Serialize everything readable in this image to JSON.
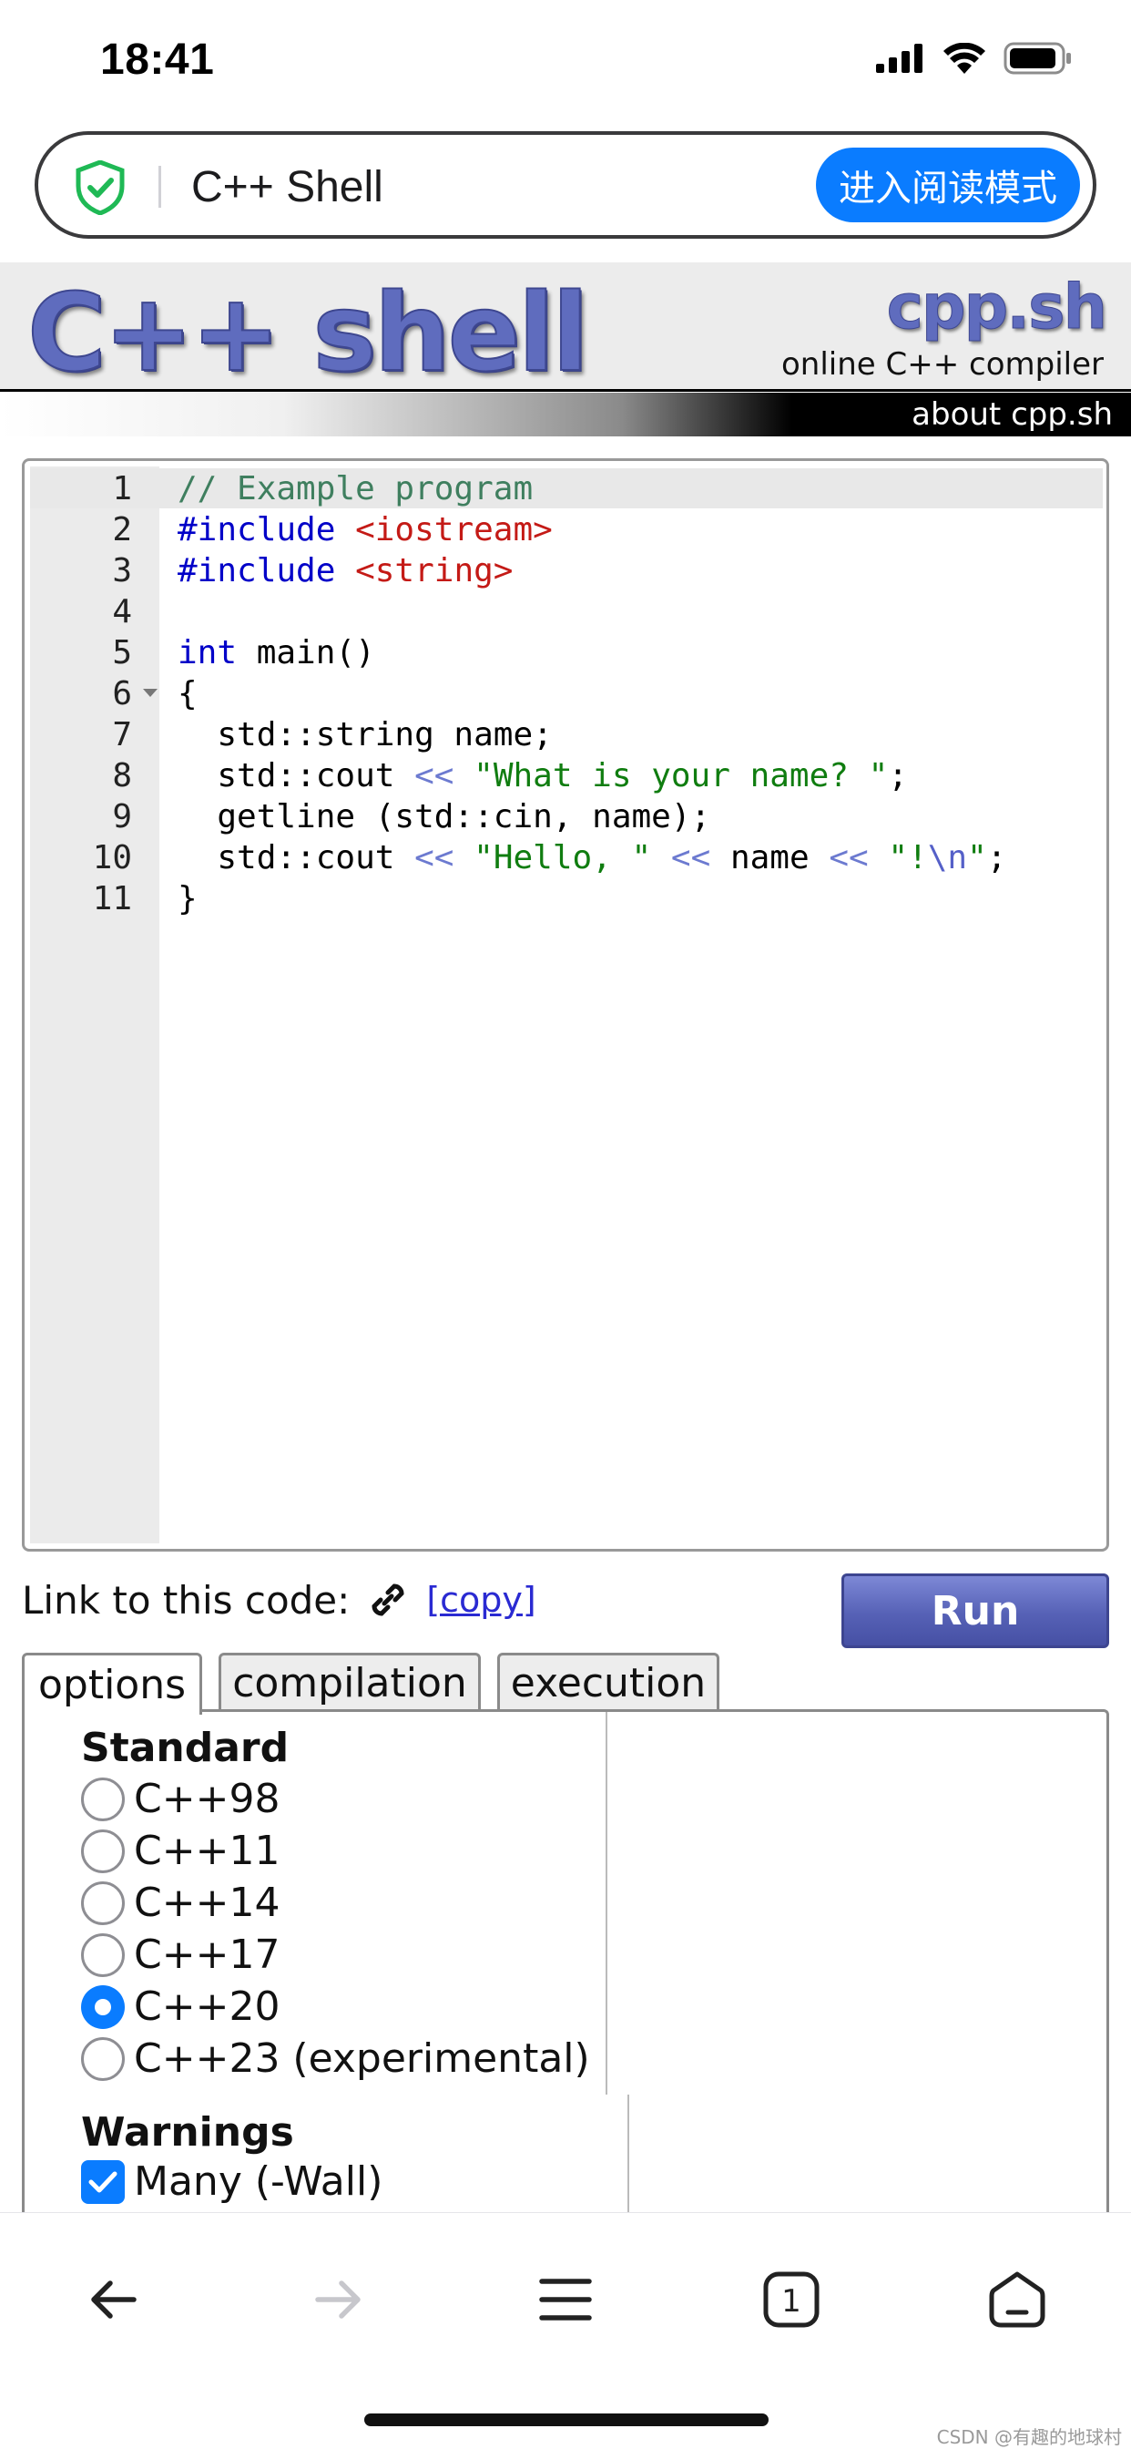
{
  "status": {
    "time": "18:41"
  },
  "browser": {
    "tab_title": "C++ Shell",
    "reader_mode_label": "进入阅读模式"
  },
  "header": {
    "logo": "C++ shell",
    "site_name": "cpp.sh",
    "tagline": "online C++ compiler",
    "about_link": "about cpp.sh"
  },
  "editor": {
    "lines": [
      {
        "n": "1",
        "segs": [
          [
            "com",
            "// Example program"
          ]
        ]
      },
      {
        "n": "2",
        "segs": [
          [
            "pre",
            "#include "
          ],
          [
            "inc",
            "<iostream>"
          ]
        ]
      },
      {
        "n": "3",
        "segs": [
          [
            "pre",
            "#include "
          ],
          [
            "inc",
            "<string>"
          ]
        ]
      },
      {
        "n": "4",
        "segs": []
      },
      {
        "n": "5",
        "segs": [
          [
            "kw",
            "int"
          ],
          [
            "txt",
            " main()"
          ]
        ]
      },
      {
        "n": "6",
        "segs": [
          [
            "txt",
            "{"
          ]
        ],
        "fold": true
      },
      {
        "n": "7",
        "segs": [
          [
            "txt",
            "  std::string name;"
          ]
        ]
      },
      {
        "n": "8",
        "segs": [
          [
            "txt",
            "  std::cout "
          ],
          [
            "op",
            "<<"
          ],
          [
            "txt",
            " "
          ],
          [
            "str",
            "\"What is your name? \""
          ],
          [
            "txt",
            ";"
          ]
        ]
      },
      {
        "n": "9",
        "segs": [
          [
            "txt",
            "  getline (std::cin, name);"
          ]
        ]
      },
      {
        "n": "10",
        "segs": [
          [
            "txt",
            "  std::cout "
          ],
          [
            "op",
            "<<"
          ],
          [
            "txt",
            " "
          ],
          [
            "str",
            "\"Hello, \""
          ],
          [
            "txt",
            " "
          ],
          [
            "op",
            "<<"
          ],
          [
            "txt",
            " name "
          ],
          [
            "op",
            "<<"
          ],
          [
            "txt",
            " "
          ],
          [
            "str",
            "\"!"
          ],
          [
            "esc",
            "\\n"
          ],
          [
            "str",
            "\""
          ],
          [
            "txt",
            ";"
          ]
        ]
      },
      {
        "n": "11",
        "segs": [
          [
            "txt",
            "}"
          ]
        ]
      }
    ]
  },
  "actions": {
    "link_label": "Link to this code:",
    "copy_label": "[copy]",
    "run_label": "Run"
  },
  "tabs": {
    "options": "options",
    "compilation": "compilation",
    "execution": "execution"
  },
  "options": {
    "standard_heading": "Standard",
    "standards": [
      {
        "label": "C++98",
        "checked": false
      },
      {
        "label": "C++11",
        "checked": false
      },
      {
        "label": "C++14",
        "checked": false
      },
      {
        "label": "C++17",
        "checked": false
      },
      {
        "label": "C++20",
        "checked": true
      },
      {
        "label": "C++23 (experimental)",
        "checked": false
      }
    ],
    "warnings_heading": "Warnings",
    "warnings": [
      {
        "label": "Many (-Wall)",
        "checked": true
      }
    ]
  },
  "footer": {
    "watermark": "CSDN @有趣的地球村"
  },
  "icons": {
    "signal": "cellular-signal-icon",
    "wifi": "wifi-icon",
    "battery": "battery-icon",
    "shield": "shield-check-icon",
    "link": "link-icon",
    "back": "back-arrow-icon",
    "forward": "forward-arrow-icon",
    "menu": "menu-icon",
    "tabs": "tabs-icon",
    "home": "home-icon"
  },
  "colors": {
    "accent": "#0a7cff",
    "logo": "#5f6cbe",
    "run_button": "#5661b6"
  }
}
